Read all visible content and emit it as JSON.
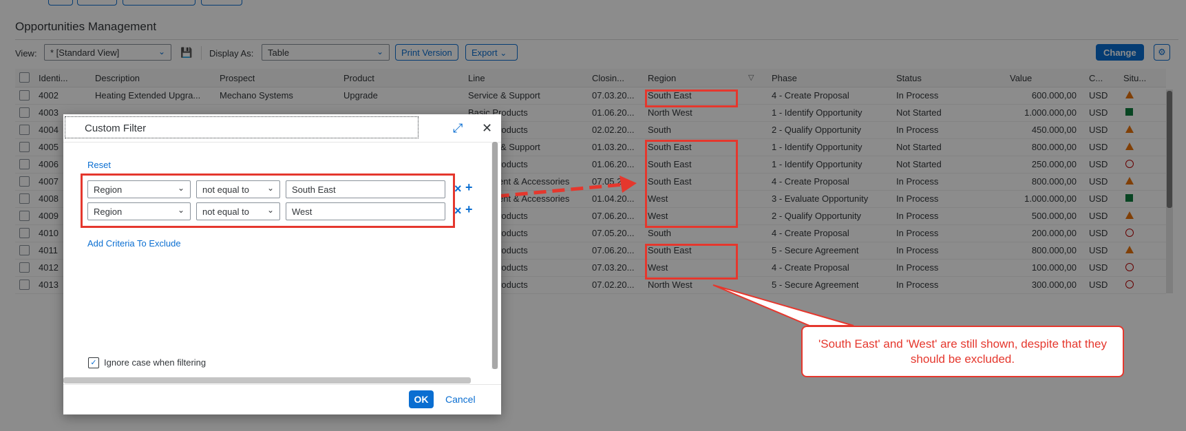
{
  "page": {
    "title": "Opportunities Management"
  },
  "toolbar": {
    "view_label": "View:",
    "view_value": "* [Standard View]",
    "display_label": "Display As:",
    "display_value": "Table",
    "print_label": "Print Version",
    "export_label": "Export",
    "change_label": "Change"
  },
  "table": {
    "columns": [
      "Identi...",
      "Description",
      "Prospect",
      "Product",
      "Line",
      "Closin...",
      "Region",
      "Phase",
      "Status",
      "Value",
      "C...",
      "Situ..."
    ],
    "rows": [
      {
        "id": "4002",
        "description": "Heating Extended Upgra...",
        "prospect": "Mechano Systems",
        "product": "Upgrade",
        "line": "Service & Support",
        "closing": "07.03.20...",
        "region": "South East",
        "phase": "4 - Create Proposal",
        "status": "In Process",
        "value": "600.000,00",
        "currency": "USD",
        "situation": "warning"
      },
      {
        "id": "4003",
        "description": "",
        "prospect": "",
        "product": "",
        "line": "Basic Products",
        "closing": "01.06.20...",
        "region": "North West",
        "phase": "1 - Identify Opportunity",
        "status": "Not Started",
        "value": "1.000.000,00",
        "currency": "USD",
        "situation": "success"
      },
      {
        "id": "4004",
        "description": "",
        "prospect": "",
        "product": "",
        "line": "Basic Products",
        "closing": "02.02.20...",
        "region": "South",
        "phase": "2 - Qualify Opportunity",
        "status": "In Process",
        "value": "450.000,00",
        "currency": "USD",
        "situation": "warning"
      },
      {
        "id": "4005",
        "description": "",
        "prospect": "",
        "product": "",
        "line": "Service & Support",
        "closing": "01.03.20...",
        "region": "South East",
        "phase": "1 - Identify Opportunity",
        "status": "Not Started",
        "value": "800.000,00",
        "currency": "USD",
        "situation": "warning"
      },
      {
        "id": "4006",
        "description": "",
        "prospect": "",
        "product": "",
        "line": "Basic Products",
        "closing": "01.06.20...",
        "region": "South East",
        "phase": "1 - Identify Opportunity",
        "status": "Not Started",
        "value": "250.000,00",
        "currency": "USD",
        "situation": "error"
      },
      {
        "id": "4007",
        "description": "",
        "prospect": "",
        "product": "",
        "line": "Equipment & Accessories",
        "closing": "07.05.20...",
        "region": "South East",
        "phase": "4 - Create Proposal",
        "status": "In Process",
        "value": "800.000,00",
        "currency": "USD",
        "situation": "warning"
      },
      {
        "id": "4008",
        "description": "",
        "prospect": "",
        "product": "",
        "line": "Equipment & Accessories",
        "closing": "01.04.20...",
        "region": "West",
        "phase": "3 - Evaluate Opportunity",
        "status": "In Process",
        "value": "1.000.000,00",
        "currency": "USD",
        "situation": "success"
      },
      {
        "id": "4009",
        "description": "",
        "prospect": "",
        "product": "",
        "line": "Basic Products",
        "closing": "07.06.20...",
        "region": "West",
        "phase": "2 - Qualify Opportunity",
        "status": "In Process",
        "value": "500.000,00",
        "currency": "USD",
        "situation": "warning"
      },
      {
        "id": "4010",
        "description": "",
        "prospect": "",
        "product": "",
        "line": "Basic Products",
        "closing": "07.05.20...",
        "region": "South",
        "phase": "4 - Create Proposal",
        "status": "In Process",
        "value": "200.000,00",
        "currency": "USD",
        "situation": "error"
      },
      {
        "id": "4011",
        "description": "",
        "prospect": "",
        "product": "",
        "line": "Basic Products",
        "closing": "07.06.20...",
        "region": "South East",
        "phase": "5 - Secure Agreement",
        "status": "In Process",
        "value": "800.000,00",
        "currency": "USD",
        "situation": "warning"
      },
      {
        "id": "4012",
        "description": "",
        "prospect": "",
        "product": "",
        "line": "Basic Products",
        "closing": "07.03.20...",
        "region": "West",
        "phase": "4 - Create Proposal",
        "status": "In Process",
        "value": "100.000,00",
        "currency": "USD",
        "situation": "error"
      },
      {
        "id": "4013",
        "description": "",
        "prospect": "",
        "product": "",
        "line": "Basic Products",
        "closing": "07.02.20...",
        "region": "North West",
        "phase": "5 - Secure Agreement",
        "status": "In Process",
        "value": "300.000,00",
        "currency": "USD",
        "situation": "error"
      }
    ]
  },
  "dialog": {
    "title": "Custom Filter",
    "reset_label": "Reset",
    "criteria": [
      {
        "field": "Region",
        "operator": "not equal to",
        "value": "South East"
      },
      {
        "field": "Region",
        "operator": "not equal to",
        "value": "West"
      }
    ],
    "add_criteria_label": "Add Criteria To Exclude",
    "ignore_case_label": "Ignore case when filtering",
    "ignore_case_checked": true,
    "ok_label": "OK",
    "cancel_label": "Cancel"
  },
  "annotation": {
    "callout_text": "'South East' and 'West' are still shown, despite that they should be excluded.",
    "color": "#e5372d"
  },
  "colors": {
    "accent": "#0a6ed1",
    "warning": "#e9730c",
    "success": "#107e3e",
    "error": "#bb0000"
  }
}
